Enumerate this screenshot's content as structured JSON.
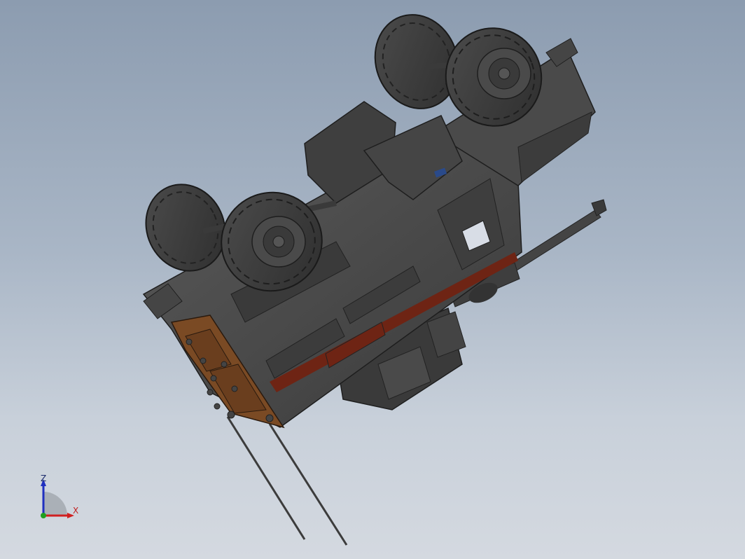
{
  "viewport": {
    "background_top": "#8c9cb0",
    "background_bottom": "#d4d9e0"
  },
  "model": {
    "subject": "armored-vehicle-icon",
    "body_color": "#4a4a4a",
    "accent_color": "#7a2a1a",
    "door_color": "#7a4a24"
  },
  "triad": {
    "z_label": "Z",
    "x_label": "X",
    "z_color": "#2030c0",
    "x_color": "#d02020",
    "y_color": "#20a020"
  }
}
